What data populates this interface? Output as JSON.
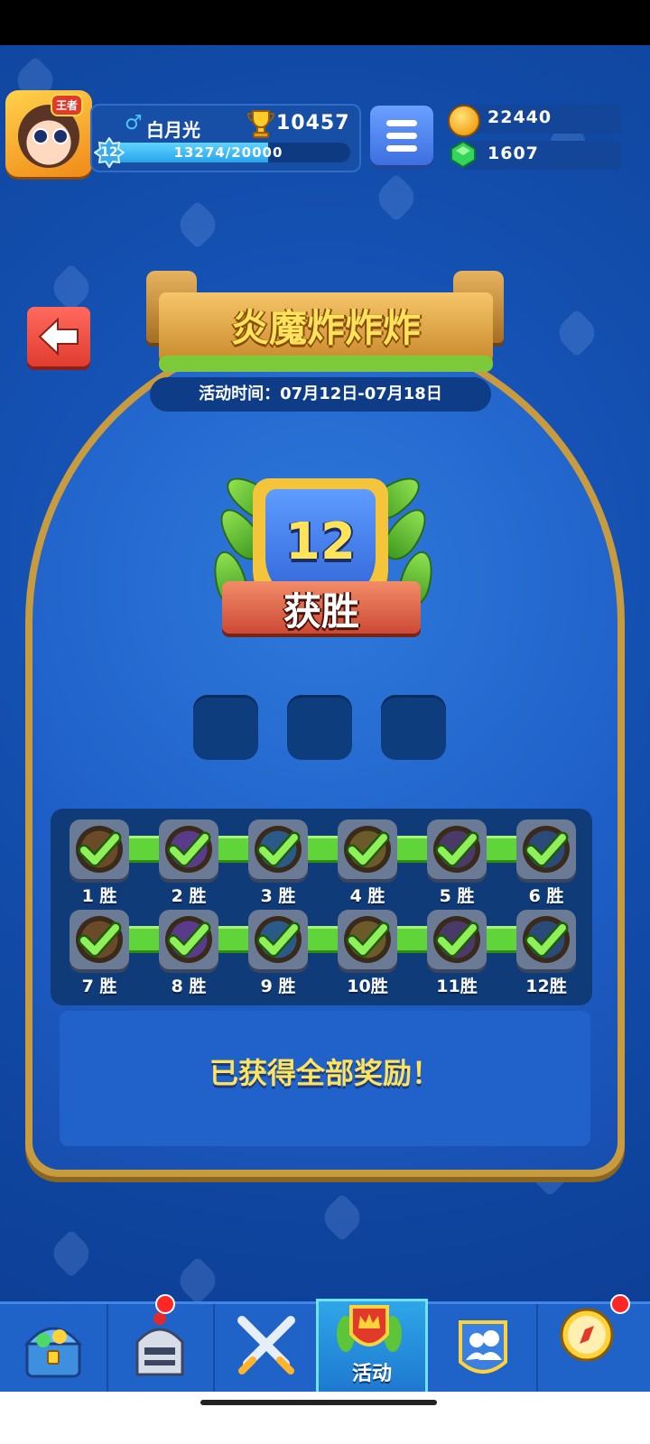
{
  "player": {
    "name": "白月光",
    "gender_symbol": "♂",
    "title_tag": "王者",
    "level": "12",
    "xp_text": "13274/20000",
    "xp_fraction": 0.6637,
    "trophies": "10457"
  },
  "currency": {
    "gold": "22440",
    "gems": "1607"
  },
  "event": {
    "title": "炎魔炸炸炸",
    "time_label": "活动时间：07月12日-07月18日",
    "wins": "12",
    "wins_label": "获胜",
    "reward_slots": 3,
    "milestones": [
      {
        "label": "1 胜",
        "done": true
      },
      {
        "label": "2 胜",
        "done": true
      },
      {
        "label": "3 胜",
        "done": true
      },
      {
        "label": "4 胜",
        "done": true
      },
      {
        "label": "5 胜",
        "done": true
      },
      {
        "label": "6 胜",
        "done": true
      },
      {
        "label": "7 胜",
        "done": true
      },
      {
        "label": "8 胜",
        "done": true
      },
      {
        "label": "9 胜",
        "done": true
      },
      {
        "label": "10胜",
        "done": true
      },
      {
        "label": "11胜",
        "done": true
      },
      {
        "label": "12胜",
        "done": true
      }
    ],
    "complete_text": "已获得全部奖励！"
  },
  "nav": {
    "items": [
      {
        "icon": "treasure-chest-icon",
        "label": ""
      },
      {
        "icon": "knight-helmet-icon",
        "label": "",
        "badge": true
      },
      {
        "icon": "crossed-swords-icon",
        "label": ""
      },
      {
        "icon": "crown-shield-icon",
        "label": "活动",
        "active": true
      },
      {
        "icon": "friends-icon",
        "label": ""
      },
      {
        "icon": "compass-icon",
        "label": "",
        "badge": true
      }
    ]
  },
  "colors": {
    "background": "#114aa6",
    "gold_text": "#ffe35c",
    "check_green": "#5fd53a",
    "back_button": "#e13c30"
  }
}
